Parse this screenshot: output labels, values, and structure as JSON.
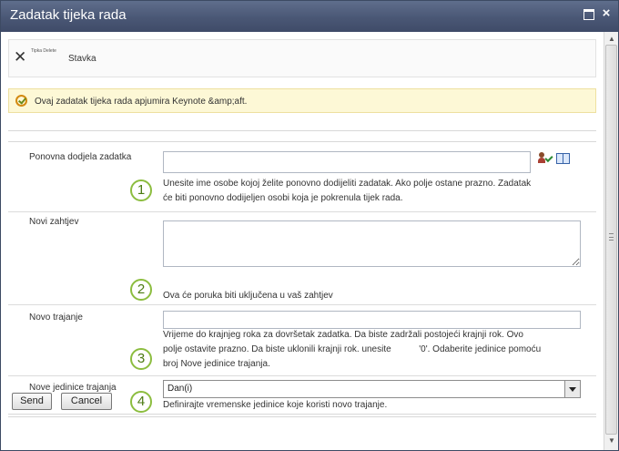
{
  "window": {
    "title": "Zadatak tijeka rada"
  },
  "icons": {
    "close": "×",
    "scroll_up": "▲",
    "scroll_down": "▼"
  },
  "ribbon": {
    "delete_label": "Tipka Delete",
    "item_label": "Stavka"
  },
  "info": {
    "text": "Ovaj zadatak tijeka rada apjumira Keynote &amp;aft."
  },
  "form": {
    "reassign": {
      "label": "Ponovna dodjela zadatka",
      "value": "",
      "description_line1": "Unesite ime osobe kojoj želite ponovno dodijeliti zadatak. Ako polje ostane prazno. Zadatak",
      "description_line2": "će biti ponovno dodijeljen osobi koja je pokrenula tijek rada.",
      "number": "1"
    },
    "new_request": {
      "label": "Novi zahtjev",
      "value": "",
      "description": "Ova će poruka biti uključena u vaš zahtjev",
      "number": "2"
    },
    "new_duration": {
      "label": "Novo trajanje",
      "value": "",
      "description_line1": "Vrijeme do krajnjeg roka za dovršetak zadatka. Da biste zadržali postojeći krajnji rok. Ovo",
      "description_line2": "polje ostavite prazno. Da biste uklonili krajnji rok. unesite           '0'. Odaberite jedinice pomoću",
      "description_line3": "broj Nove jedinice trajanja.",
      "number": "3"
    },
    "duration_units": {
      "label": "Nove jedinice trajanja",
      "selected": "Dan(i)",
      "description": "Definirajte vremenske jedinice koje koristi novo trajanje.",
      "number": "4"
    }
  },
  "buttons": {
    "send": "Send",
    "cancel": "Cancel"
  },
  "colors": {
    "titlebar": "#4a5775",
    "infobar": "#fdf8d6",
    "badge_border": "#8cbd3f"
  }
}
